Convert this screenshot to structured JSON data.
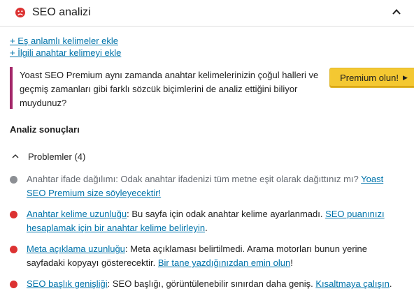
{
  "header": {
    "title": "SEO analizi",
    "status_icon": "sad-face-icon",
    "status_color": "#dc3232",
    "toggle_icon": "chevron-up-icon"
  },
  "links": [
    "+ Eş anlamlı kelimeler ekle",
    "+ İlgili anahtar kelimeyi ekle"
  ],
  "upsell": {
    "text": "Yoast SEO Premium aynı zamanda anahtar kelimelerinizin çoğul halleri ve geçmiş zamanları gibi farklı sözcük biçimlerini de analiz ettiğini biliyor muydunuz?",
    "button_label": "Premium olun!",
    "button_color": "#f4c832",
    "border_color": "#a4286a"
  },
  "analysis": {
    "title": "Analiz sonuçları",
    "group_label": "Problemler (4)",
    "items": [
      {
        "status": "gray",
        "before": "Anahtar ifade dağılımı: Odak anahtar ifadenizi tüm metne eşit olarak dağıttınız mı? ",
        "link": "Yoast SEO Premium size söyleyecektir!",
        "after": ""
      },
      {
        "status": "red",
        "title_link": "Anahtar kelime uzunluğu",
        "before": ": Bu sayfa için odak anahtar kelime ayarlanmadı. ",
        "link": "SEO puanınızı hesaplamak için bir anahtar kelime belirleyin",
        "after": "."
      },
      {
        "status": "red",
        "title_link": "Meta açıklama uzunluğu",
        "before": ": Meta açıklaması belirtilmedi. Arama motorları bunun yerine sayfadaki kopyayı gösterecektir. ",
        "link": "Bir tane yazdığınızdan emin olun",
        "after": "!"
      },
      {
        "status": "red",
        "title_link": "SEO başlık genişliği",
        "before": ": SEO başlığı, görüntülenebilir sınırdan daha geniş. ",
        "link": "Kısaltmaya çalışın",
        "after": "."
      }
    ]
  }
}
